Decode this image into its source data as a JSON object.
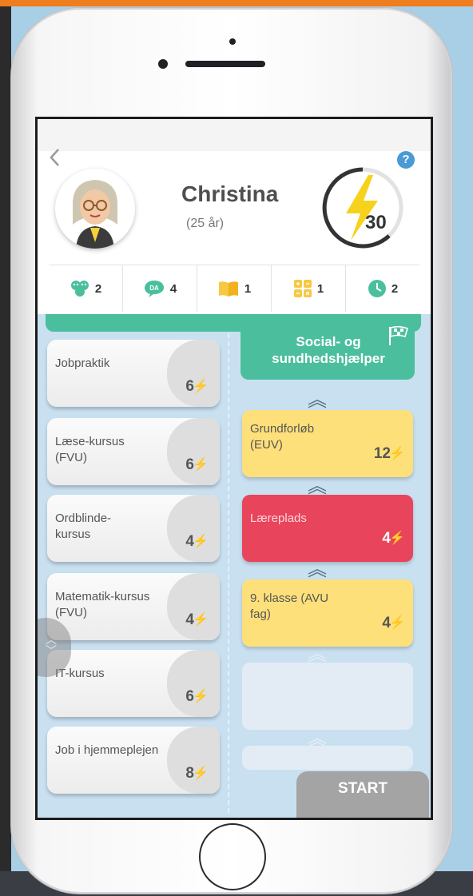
{
  "header": {
    "back_icon": "chevron-left-icon",
    "help_label": "?",
    "name": "Christina",
    "age": "(25 år)",
    "score": "30"
  },
  "stats": [
    {
      "icon": "people-icon",
      "color": "#4bbf9d",
      "value": "2"
    },
    {
      "icon": "da-speech-icon",
      "color": "#4bbf9d",
      "value": "4"
    },
    {
      "icon": "book-icon",
      "color": "#f7c842",
      "value": "1"
    },
    {
      "icon": "calculator-icon",
      "color": "#f7c842",
      "value": "1"
    },
    {
      "icon": "clock-icon",
      "color": "#4bbf9d",
      "value": "2"
    }
  ],
  "courses": [
    {
      "label": "Jobpraktik",
      "value": "6"
    },
    {
      "label": "Læse-kursus (FVU)",
      "value": "6"
    },
    {
      "label": "Ordblinde-kursus",
      "value": "4"
    },
    {
      "label": "Matematik-kursus (FVU)",
      "value": "4"
    },
    {
      "label": "IT-kursus",
      "value": "6"
    },
    {
      "label": "Job i hjemmeplejen",
      "value": "8"
    }
  ],
  "goal": {
    "label": "Social- og sundhedshjælper"
  },
  "path": [
    {
      "label": "Grundforløb (EUV)",
      "value": "12",
      "status": "yellow"
    },
    {
      "label": "Læreplads",
      "value": "4",
      "status": "red"
    },
    {
      "label": "9. klasse (AVU fag)",
      "value": "4",
      "status": "yellow"
    }
  ],
  "bolt_glyph": "⚡",
  "start_label": "START",
  "colors": {
    "accent_green": "#4bbf9d",
    "yellow": "#fde07a",
    "red": "#e8445b",
    "background": "#c9e0f1"
  }
}
